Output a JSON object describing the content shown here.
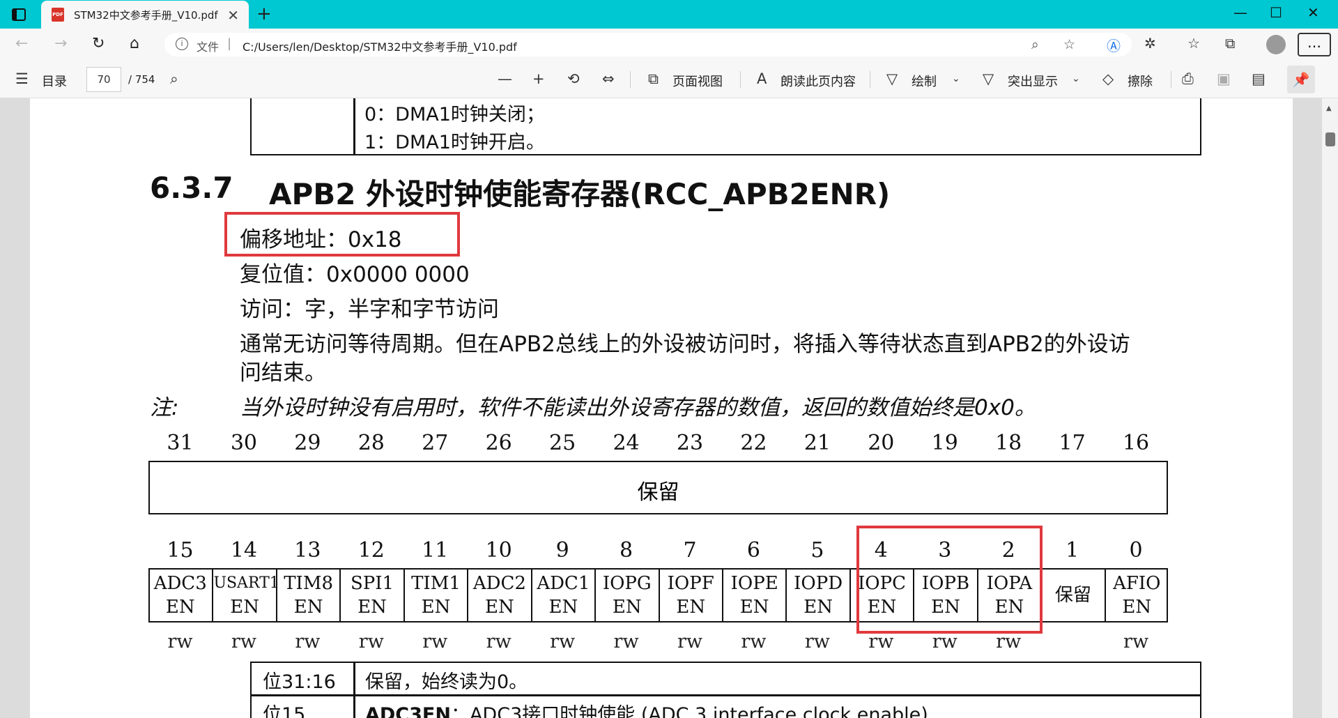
{
  "tab": {
    "title": "STM32中文参考手册_V10.pdf",
    "icon": "pdf-file-icon",
    "badge": "PDF"
  },
  "window_controls": {
    "minimize": "—",
    "maximize": "☐",
    "close": "✕"
  },
  "address": {
    "scheme": "文件",
    "url": "C:/Users/len/Desktop/STM32中文参考手册_V10.pdf"
  },
  "pdf_toolbar": {
    "toc": "目录",
    "page_current": "70",
    "page_total": "/ 754",
    "page_view": "页面视图",
    "read_aloud": "朗读此页内容",
    "draw": "绘制",
    "highlight": "突出显示",
    "erase": "擦除"
  },
  "prev_table": {
    "row0": "0：DMA1时钟关闭；",
    "row1": "1：DMA1时钟开启。"
  },
  "section": {
    "number": "6.3.7",
    "title": "APB2 外设时钟使能寄存器(RCC_APB2ENR)",
    "offset": "偏移地址：0x18",
    "reset": "复位值：0x0000 0000",
    "access": "访问：字，半字和字节访问",
    "desc_line1": "通常无访问等待周期。但在APB2总线上的外设被访问时，将插入等待状态直到APB2的外设访",
    "desc_line2": "问结束。",
    "note_label": "注:",
    "note_text": "当外设时钟没有启用时，软件不能读出外设寄存器的数值，返回的数值始终是0x0。"
  },
  "register": {
    "high_bits": [
      "31",
      "30",
      "29",
      "28",
      "27",
      "26",
      "25",
      "24",
      "23",
      "22",
      "21",
      "20",
      "19",
      "18",
      "17",
      "16"
    ],
    "high_field": "保留",
    "low_bits": [
      "15",
      "14",
      "13",
      "12",
      "11",
      "10",
      "9",
      "8",
      "7",
      "6",
      "5",
      "4",
      "3",
      "2",
      "1",
      "0"
    ],
    "fields": [
      {
        "name": "ADC3",
        "sub": "EN",
        "access": "rw"
      },
      {
        "name": "USART1",
        "sub": "EN",
        "access": "rw"
      },
      {
        "name": "TIM8",
        "sub": "EN",
        "access": "rw"
      },
      {
        "name": "SPI1",
        "sub": "EN",
        "access": "rw"
      },
      {
        "name": "TIM1",
        "sub": "EN",
        "access": "rw"
      },
      {
        "name": "ADC2",
        "sub": "EN",
        "access": "rw"
      },
      {
        "name": "ADC1",
        "sub": "EN",
        "access": "rw"
      },
      {
        "name": "IOPG",
        "sub": "EN",
        "access": "rw"
      },
      {
        "name": "IOPF",
        "sub": "EN",
        "access": "rw"
      },
      {
        "name": "IOPE",
        "sub": "EN",
        "access": "rw"
      },
      {
        "name": "IOPD",
        "sub": "EN",
        "access": "rw"
      },
      {
        "name": "IOPC",
        "sub": "EN",
        "access": "rw"
      },
      {
        "name": "IOPB",
        "sub": "EN",
        "access": "rw"
      },
      {
        "name": "IOPA",
        "sub": "EN",
        "access": "rw"
      },
      {
        "name": "保留",
        "sub": "",
        "access": ""
      },
      {
        "name": "AFIO",
        "sub": "EN",
        "access": "rw"
      }
    ]
  },
  "bit_table": [
    {
      "bits": "位31:16",
      "desc": "保留，始终读为0。"
    },
    {
      "bits": "位15",
      "desc_bold": "ADC3EN",
      "desc": "：ADC3接口时钟使能 (ADC 3 interface clock enable)"
    }
  ],
  "highlight_color": "#e03a3e"
}
